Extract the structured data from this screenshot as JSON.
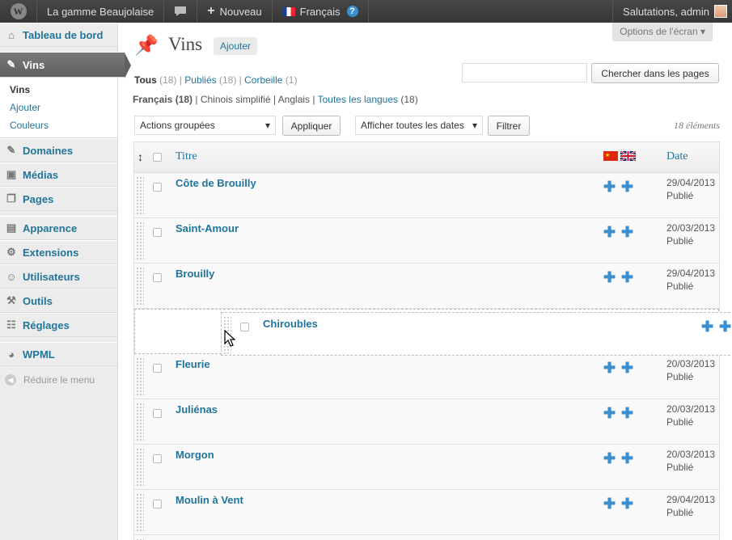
{
  "adminbar": {
    "site_name": "La gamme Beaujolaise",
    "new_label": "Nouveau",
    "language": "Français",
    "greeting": "Salutations, admin"
  },
  "sidebar": {
    "dashboard": "Tableau de bord",
    "current": "Vins",
    "submenu": [
      "Vins",
      "Ajouter",
      "Couleurs"
    ],
    "items": [
      "Domaines",
      "Médias",
      "Pages",
      "Apparence",
      "Extensions",
      "Utilisateurs",
      "Outils",
      "Réglages",
      "WPML"
    ],
    "collapse": "Réduire le menu"
  },
  "header": {
    "screen_options": "Options de l'écran",
    "title": "Vins",
    "add_new": "Ajouter"
  },
  "filters": {
    "all": "Tous",
    "all_count": "(18)",
    "published": "Publiés",
    "published_count": "(18)",
    "trash": "Corbeille",
    "trash_count": "(1)"
  },
  "languages": {
    "french": "Français (18)",
    "chinese": "Chinois simplifié",
    "english": "Anglais",
    "all": "Toutes les langues",
    "all_count": "(18)"
  },
  "search": {
    "value": "",
    "button": "Chercher dans les pages"
  },
  "bulk": {
    "actions": "Actions groupées",
    "apply": "Appliquer",
    "dates": "Afficher toutes les dates",
    "filter": "Filtrer"
  },
  "item_count": "18 éléments",
  "table": {
    "col_sort": "↕",
    "col_title": "Titre",
    "col_date": "Date",
    "rows_top": [
      {
        "title": "Côte de Brouilly",
        "date": "29/04/2013",
        "status": "Publié"
      },
      {
        "title": "Saint-Amour",
        "date": "20/03/2013",
        "status": "Publié"
      },
      {
        "title": "Brouilly",
        "date": "29/04/2013",
        "status": "Publié"
      }
    ],
    "dragged": {
      "title": "Chiroubles"
    },
    "rows_bottom": [
      {
        "title": "Fleurie",
        "date": "20/03/2013",
        "status": "Publié"
      },
      {
        "title": "Juliénas",
        "date": "20/03/2013",
        "status": "Publié"
      },
      {
        "title": "Morgon",
        "date": "20/03/2013",
        "status": "Publié"
      },
      {
        "title": "Moulin à Vent",
        "date": "29/04/2013",
        "status": "Publié"
      }
    ]
  }
}
